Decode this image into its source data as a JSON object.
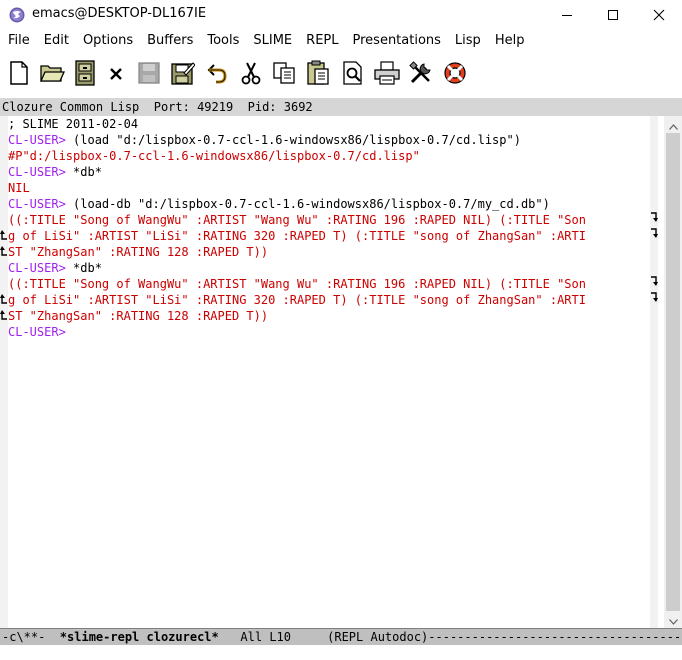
{
  "window": {
    "title": "emacs@DESKTOP-DL167IE",
    "controls": [
      "minimize",
      "maximize",
      "close"
    ]
  },
  "menu": [
    "File",
    "Edit",
    "Options",
    "Buffers",
    "Tools",
    "SLIME",
    "REPL",
    "Presentations",
    "Lisp",
    "Help"
  ],
  "toolbar": {
    "icons": [
      "new-file-icon",
      "open-folder-icon",
      "dired-icon",
      "close-buffer-icon",
      "save-icon",
      "save-as-icon",
      "undo-icon",
      "cut-icon",
      "copy-icon",
      "paste-icon",
      "search-icon",
      "print-icon",
      "preferences-icon",
      "help-icon"
    ]
  },
  "header_line": "Clozure Common Lisp  Port: 49219  Pid: 3692",
  "buffer": {
    "lines": [
      {
        "parts": [
          {
            "text": "; SLIME 2011-02-04",
            "style": "normal"
          }
        ]
      },
      {
        "parts": [
          {
            "text": "CL-USER>",
            "style": "prompt"
          },
          {
            "text": " (load \"d:/lispbox-0.7-ccl-1.6-windowsx86/lispbox-0.7/cd.lisp\")",
            "style": "normal"
          }
        ]
      },
      {
        "parts": [
          {
            "text": "#P\"d:/lispbox-0.7-ccl-1.6-windowsx86/lispbox-0.7/cd.lisp\"",
            "style": "out"
          }
        ]
      },
      {
        "parts": [
          {
            "text": "CL-USER>",
            "style": "prompt"
          },
          {
            "text": " *db*",
            "style": "normal"
          }
        ]
      },
      {
        "parts": [
          {
            "text": "NIL",
            "style": "out"
          }
        ]
      },
      {
        "parts": [
          {
            "text": "CL-USER>",
            "style": "prompt"
          },
          {
            "text": " (load-db \"d:/lispbox-0.7-ccl-1.6-windowsx86/lispbox-0.7/my_cd.db\")",
            "style": "normal"
          }
        ]
      },
      {
        "parts": [
          {
            "text": "((:TITLE \"Song of WangWu\" :ARTIST \"Wang Wu\" :RATING 196 :RAPED NIL) (:TITLE \"Son",
            "style": "out"
          }
        ],
        "wrap_right": true
      },
      {
        "parts": [
          {
            "text": "g of LiSi\" :ARTIST \"LiSi\" :RATING 320 :RAPED T) (:TITLE \"song of ZhangSan\" :ARTI",
            "style": "out"
          }
        ],
        "wrap_left": true,
        "wrap_right": true
      },
      {
        "parts": [
          {
            "text": "ST \"ZhangSan\" :RATING 128 :RAPED T))",
            "style": "out"
          }
        ],
        "wrap_left": true
      },
      {
        "parts": [
          {
            "text": "CL-USER>",
            "style": "prompt"
          },
          {
            "text": " *db*",
            "style": "normal"
          }
        ]
      },
      {
        "parts": [
          {
            "text": "((:TITLE \"Song of WangWu\" :ARTIST \"Wang Wu\" :RATING 196 :RAPED NIL) (:TITLE \"Son",
            "style": "out"
          }
        ],
        "wrap_right": true
      },
      {
        "parts": [
          {
            "text": "g of LiSi\" :ARTIST \"LiSi\" :RATING 320 :RAPED T) (:TITLE \"song of ZhangSan\" :ARTI",
            "style": "out"
          }
        ],
        "wrap_left": true,
        "wrap_right": true
      },
      {
        "parts": [
          {
            "text": "ST \"ZhangSan\" :RATING 128 :RAPED T))",
            "style": "out"
          }
        ],
        "wrap_left": true
      },
      {
        "parts": [
          {
            "text": "CL-USER>",
            "style": "prompt"
          }
        ]
      }
    ]
  },
  "mode_line": {
    "status": "-c\\**-  ",
    "buffer_name": "*slime-repl clozurecl*",
    "position": "   All L10     ",
    "modes": "(REPL Autodoc)",
    "fill": "-----------------------------------------------------"
  },
  "colors": {
    "prompt": "#a020f0",
    "output": "#cc0000",
    "mode_line_bg": "#bfbfbf",
    "header_line_bg": "#d6d6d6"
  }
}
